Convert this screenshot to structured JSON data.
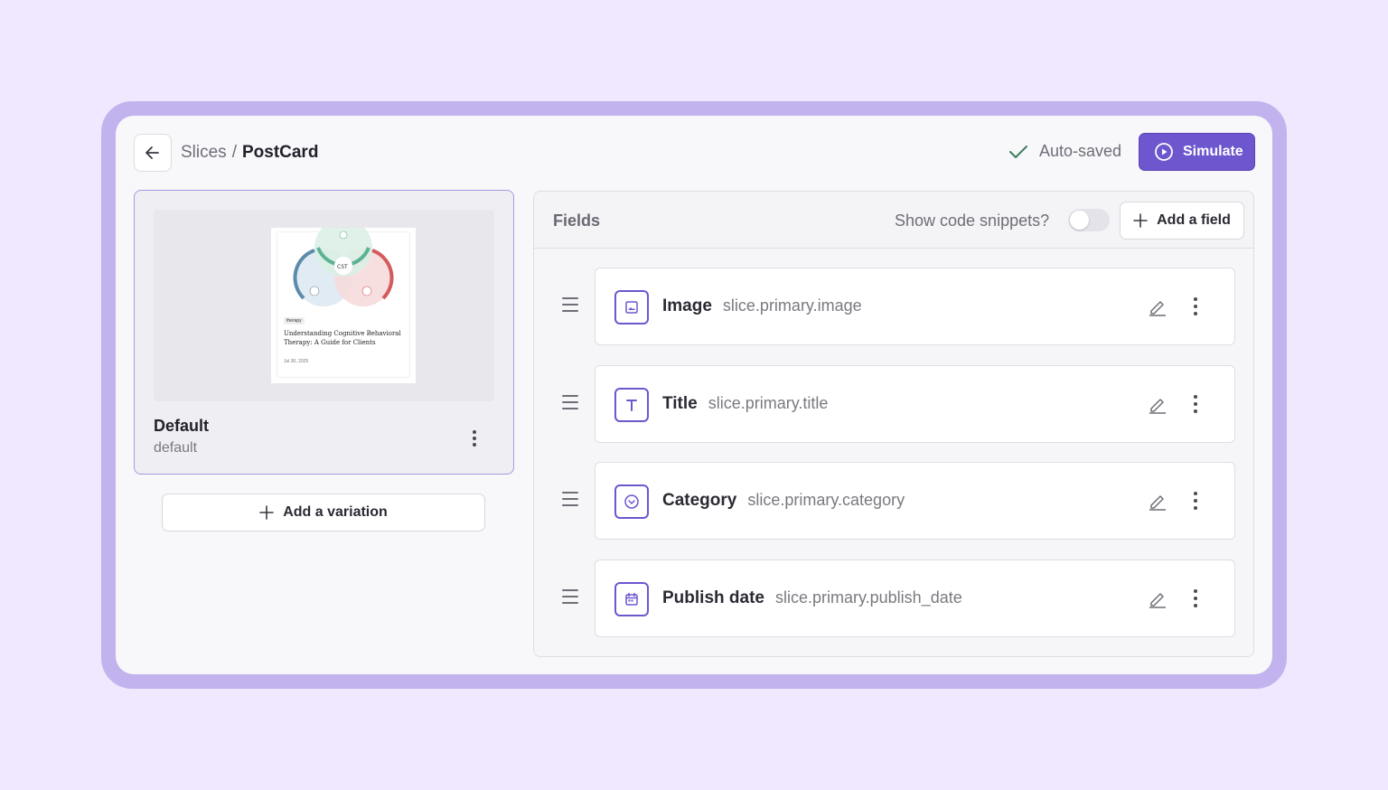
{
  "header": {
    "breadcrumb_parent": "Slices",
    "breadcrumb_separator": "/",
    "breadcrumb_current": "PostCard",
    "autosave_label": "Auto-saved",
    "simulate_label": "Simulate"
  },
  "variation": {
    "name": "Default",
    "id": "default",
    "add_label": "Add a variation",
    "preview": {
      "diagram_center": "CST",
      "tag": "therapy",
      "title": "Understanding Cognitive Behavioral Therapy: A Guide for Clients",
      "date": "Jul 30, 2025"
    }
  },
  "fields": {
    "title": "Fields",
    "snippets_label": "Show code snippets?",
    "snippets_enabled": false,
    "add_label": "Add a field",
    "items": [
      {
        "name": "Image",
        "path": "slice.primary.image",
        "icon": "image-icon"
      },
      {
        "name": "Title",
        "path": "slice.primary.title",
        "icon": "text-icon"
      },
      {
        "name": "Category",
        "path": "slice.primary.category",
        "icon": "select-icon"
      },
      {
        "name": "Publish date",
        "path": "slice.primary.publish_date",
        "icon": "calendar-icon"
      }
    ]
  },
  "colors": {
    "accent": "#6e56cf",
    "background": "#efe8ff",
    "frame": "#c2b3ee",
    "success": "#3d7f5c"
  }
}
